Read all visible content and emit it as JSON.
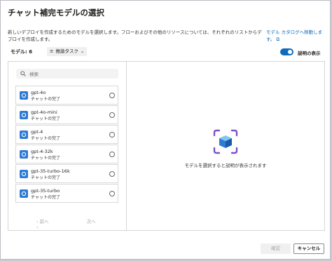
{
  "dialog": {
    "title": "チャット補完モデルの選択",
    "description": "新しいデプロイを作成するためのモデルを選択します。フローおよびその他のリソースについては、それぞれのリストからデプロイを作成します。",
    "catalog_link": "モデル カタログへ移動します。"
  },
  "toolbar": {
    "model_count": "モデル: 6",
    "sort_label": "推論タスク",
    "toggle_label": "説明の表示",
    "toggle_on": true
  },
  "search": {
    "placeholder": "検索"
  },
  "models": [
    {
      "name": "gpt-4o",
      "task": "チャットの完了"
    },
    {
      "name": "gpt-4o-mini",
      "task": "チャットの完了"
    },
    {
      "name": "gpt-4",
      "task": "チャットの完了"
    },
    {
      "name": "gpt-4-32k",
      "task": "チャットの完了"
    },
    {
      "name": "gpt-35-turbo-16k",
      "task": "チャットの完了"
    },
    {
      "name": "gpt-35-turbo",
      "task": "チャットの完了"
    }
  ],
  "pager": {
    "prev": "前へ",
    "next": "次へ"
  },
  "detail": {
    "empty_text": "モデルを選択すると説明が表示されます"
  },
  "buttons": {
    "confirm": "確認",
    "cancel": "キャンセル"
  },
  "colors": {
    "accent": "#0f6cbd",
    "icon_purple": "#7b52c9"
  }
}
